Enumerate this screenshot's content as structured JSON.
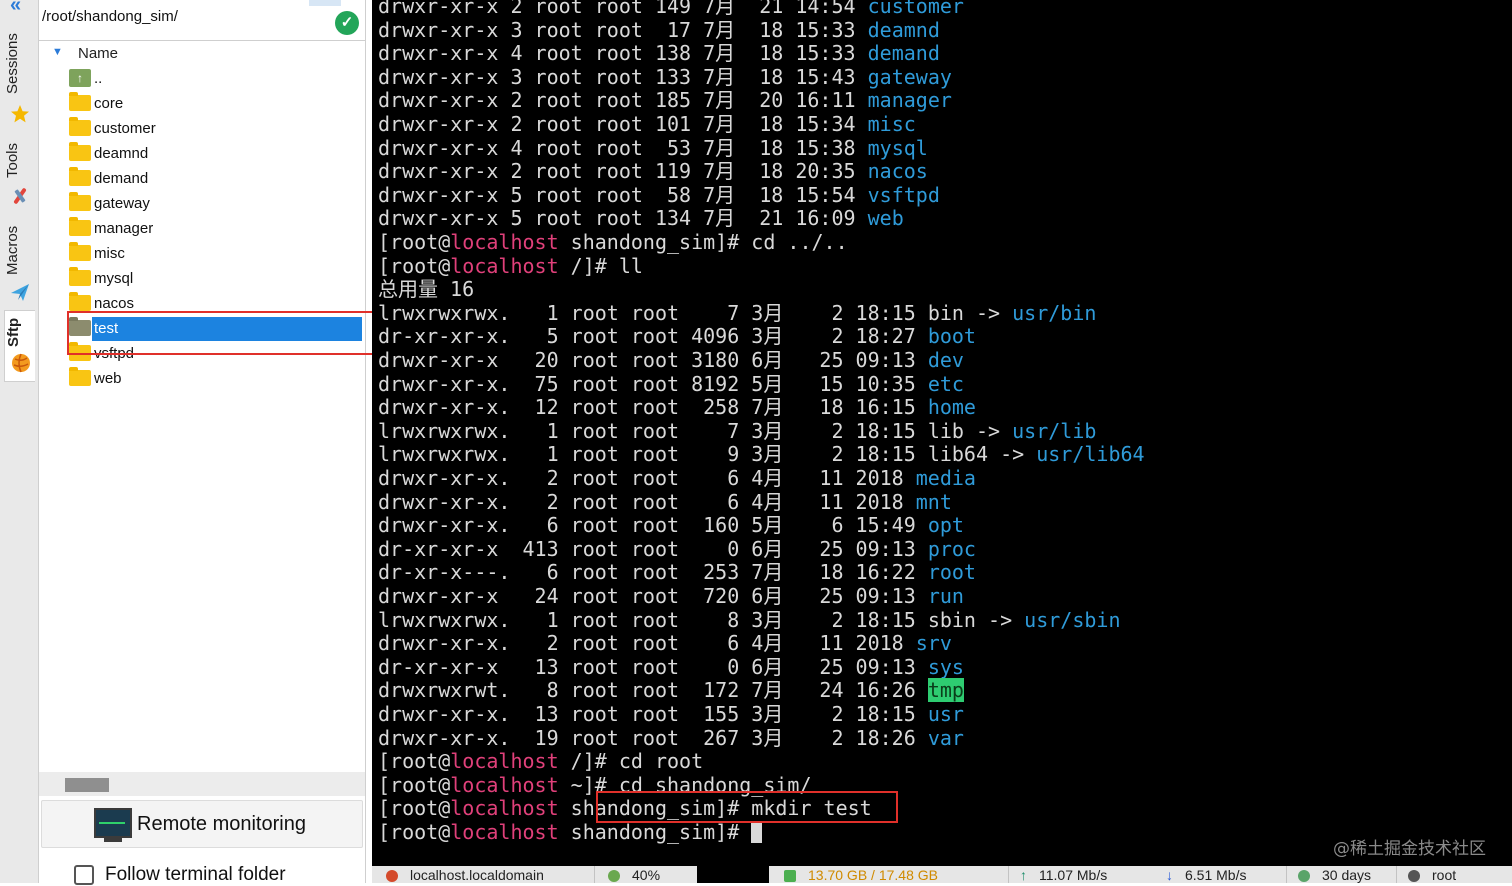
{
  "side_tabs": [
    {
      "label": "Sessions",
      "icon": "star-icon"
    },
    {
      "label": "Tools",
      "icon": "tools-icon"
    },
    {
      "label": "Macros",
      "icon": "paper-plane-icon"
    },
    {
      "label": "Sftp",
      "icon": "globe-icon",
      "active": true
    }
  ],
  "sftp": {
    "path": "/root/shandong_sim/",
    "column_name": "Name",
    "files": [
      {
        "name": "..",
        "type": "up"
      },
      {
        "name": "core",
        "type": "folder"
      },
      {
        "name": "customer",
        "type": "folder"
      },
      {
        "name": "deamnd",
        "type": "folder"
      },
      {
        "name": "demand",
        "type": "folder"
      },
      {
        "name": "gateway",
        "type": "folder"
      },
      {
        "name": "manager",
        "type": "folder"
      },
      {
        "name": "misc",
        "type": "folder"
      },
      {
        "name": "mysql",
        "type": "folder"
      },
      {
        "name": "nacos",
        "type": "folder"
      },
      {
        "name": "test",
        "type": "folder",
        "selected": true
      },
      {
        "name": "vsftpd",
        "type": "folder"
      },
      {
        "name": "web",
        "type": "folder"
      }
    ],
    "remote_monitoring_label": "Remote monitoring",
    "follow_terminal_label": "Follow terminal folder"
  },
  "terminal": {
    "prompt_user": "[root@",
    "prompt_host": "localhost",
    "lines": [
      {
        "perm": "drwxr-xr-x 2 root root 149 7月  21 14:54 ",
        "name": "customer",
        "color": "blue"
      },
      {
        "perm": "drwxr-xr-x 3 root root  17 7月  18 15:33 ",
        "name": "deamnd",
        "color": "blue"
      },
      {
        "perm": "drwxr-xr-x 4 root root 138 7月  18 15:33 ",
        "name": "demand",
        "color": "blue"
      },
      {
        "perm": "drwxr-xr-x 3 root root 133 7月  18 15:43 ",
        "name": "gateway",
        "color": "blue"
      },
      {
        "perm": "drwxr-xr-x 2 root root 185 7月  20 16:11 ",
        "name": "manager",
        "color": "blue"
      },
      {
        "perm": "drwxr-xr-x 2 root root 101 7月  18 15:34 ",
        "name": "misc",
        "color": "blue"
      },
      {
        "perm": "drwxr-xr-x 4 root root  53 7月  18 15:38 ",
        "name": "mysql",
        "color": "blue"
      },
      {
        "perm": "drwxr-xr-x 2 root root 119 7月  18 20:35 ",
        "name": "nacos",
        "color": "blue"
      },
      {
        "perm": "drwxr-xr-x 5 root root  58 7月  18 15:54 ",
        "name": "vsftpd",
        "color": "blue"
      },
      {
        "perm": "drwxr-xr-x 5 root root 134 7月  21 16:09 ",
        "name": "web",
        "color": "blue"
      },
      {
        "prompt_dir": " shandong_sim]# ",
        "cmd": "cd ../.."
      },
      {
        "prompt_dir": " /]# ",
        "cmd": "ll"
      },
      {
        "plain": "总用量 16"
      },
      {
        "perm": "lrwxrwxrwx.   1 root root    7 3月    2 18:15 ",
        "name": "bin",
        "color": "plain",
        "arrow": " -> ",
        "target": "usr/bin"
      },
      {
        "perm": "dr-xr-xr-x.   5 root root 4096 3月    2 18:27 ",
        "name": "boot",
        "color": "blue"
      },
      {
        "perm": "drwxr-xr-x   20 root root 3180 6月   25 09:13 ",
        "name": "dev",
        "color": "blue"
      },
      {
        "perm": "drwxr-xr-x.  75 root root 8192 5月   15 10:35 ",
        "name": "etc",
        "color": "blue"
      },
      {
        "perm": "drwxr-xr-x.  12 root root  258 7月   18 16:15 ",
        "name": "home",
        "color": "blue"
      },
      {
        "perm": "lrwxrwxrwx.   1 root root    7 3月    2 18:15 ",
        "name": "lib",
        "color": "plain",
        "arrow": " -> ",
        "target": "usr/lib"
      },
      {
        "perm": "lrwxrwxrwx.   1 root root    9 3月    2 18:15 ",
        "name": "lib64",
        "color": "plain",
        "arrow": " -> ",
        "target": "usr/lib64"
      },
      {
        "perm": "drwxr-xr-x.   2 root root    6 4月   11 2018 ",
        "name": "media",
        "color": "blue"
      },
      {
        "perm": "drwxr-xr-x.   2 root root    6 4月   11 2018 ",
        "name": "mnt",
        "color": "blue"
      },
      {
        "perm": "drwxr-xr-x.   6 root root  160 5月    6 15:49 ",
        "name": "opt",
        "color": "blue"
      },
      {
        "perm": "dr-xr-xr-x  413 root root    0 6月   25 09:13 ",
        "name": "proc",
        "color": "blue"
      },
      {
        "perm": "dr-xr-x---.   6 root root  253 7月   18 16:22 ",
        "name": "root",
        "color": "blue"
      },
      {
        "perm": "drwxr-xr-x   24 root root  720 6月   25 09:13 ",
        "name": "run",
        "color": "blue"
      },
      {
        "perm": "lrwxrwxrwx.   1 root root    8 3月    2 18:15 ",
        "name": "sbin",
        "color": "plain",
        "arrow": " -> ",
        "target": "usr/sbin"
      },
      {
        "perm": "drwxr-xr-x.   2 root root    6 4月   11 2018 ",
        "name": "srv",
        "color": "blue"
      },
      {
        "perm": "dr-xr-xr-x   13 root root    0 6月   25 09:13 ",
        "name": "sys",
        "color": "blue"
      },
      {
        "perm": "drwxrwxrwt.   8 root root  172 7月   24 16:26 ",
        "name": "tmp",
        "color": "tmp"
      },
      {
        "perm": "drwxr-xr-x.  13 root root  155 3月    2 18:15 ",
        "name": "usr",
        "color": "blue"
      },
      {
        "perm": "drwxr-xr-x.  19 root root  267 3月    2 18:26 ",
        "name": "var",
        "color": "blue"
      },
      {
        "prompt_dir": " /]# ",
        "cmd": "cd root"
      },
      {
        "prompt_dir": " ~]# ",
        "cmd": "cd shandong_sim/"
      },
      {
        "prompt_dir": " shandong_sim]# ",
        "cmd": "mkdir test"
      },
      {
        "prompt_dir": " shandong_sim]# ",
        "cmd": "",
        "cursor": true
      }
    ],
    "watermark": "@稀土掘金技术社区"
  },
  "status_bar": {
    "host": "localhost.localdomain",
    "cpu": "40%",
    "disk": "13.70 GB / 17.48 GB",
    "upload": "11.07 Mb/s",
    "download": "6.51 Mb/s",
    "uptime": "30 days",
    "user": "root"
  },
  "colors": {
    "terminal_bg": "#000000",
    "terminal_fg": "#d9d9d9",
    "dir_blue": "#2f9bd9",
    "host_pink": "#e0407a",
    "selection_blue": "#1c83e0",
    "highlight_red": "#e0302a"
  }
}
